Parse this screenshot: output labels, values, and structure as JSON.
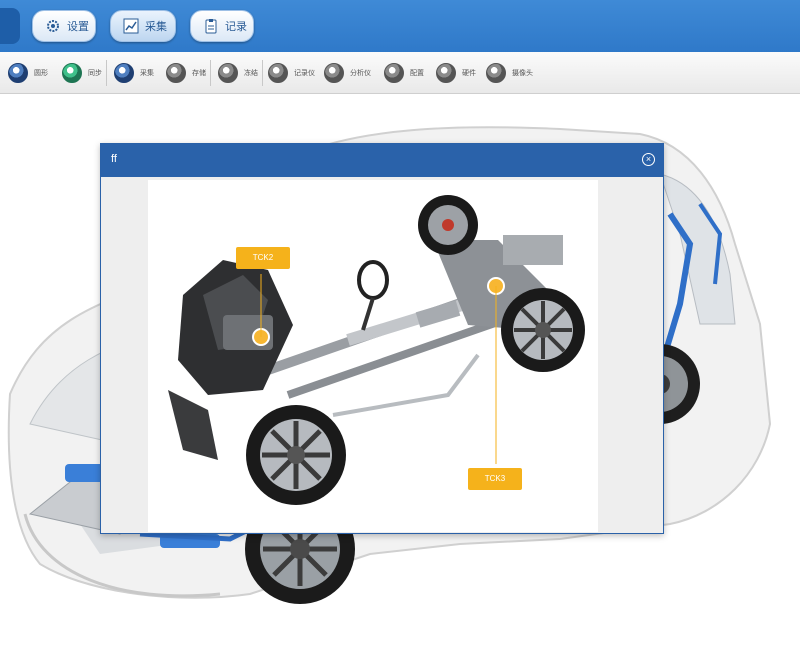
{
  "toolbar": {
    "buttons": [
      {
        "label": "设置",
        "icon": "gear-icon"
      },
      {
        "label": "采集",
        "icon": "chart-icon"
      },
      {
        "label": "记录",
        "icon": "clipboard-icon"
      }
    ]
  },
  "subtoolbar": {
    "items": [
      {
        "label": "圆形",
        "icon": "circle-gauge-icon"
      },
      {
        "label": "同步",
        "icon": "sync-gauge-icon"
      },
      {
        "label": "采集",
        "icon": "capture-gauge-icon"
      },
      {
        "label": "存储",
        "icon": "storage-gauge-icon"
      },
      {
        "label": "冻结",
        "icon": "freeze-gauge-icon"
      },
      {
        "label": "记录仪",
        "icon": "recorder-gauge-icon"
      },
      {
        "label": "分析仪",
        "icon": "analyzer-gauge-icon"
      },
      {
        "label": "配置",
        "icon": "config-gauge-icon"
      },
      {
        "label": "硬件",
        "icon": "hardware-gauge-icon"
      },
      {
        "label": "摄像头",
        "icon": "camera-gauge-icon"
      }
    ]
  },
  "dialog": {
    "title": "ff",
    "close_icon": "close-icon",
    "tags": [
      "TCK2",
      "TCK3"
    ]
  },
  "colors": {
    "toolbar_blue": "#3f8ad6",
    "dialog_header": "#2a62aa",
    "tag_orange": "#f5b21b",
    "tag_dot": "#f7b733"
  }
}
